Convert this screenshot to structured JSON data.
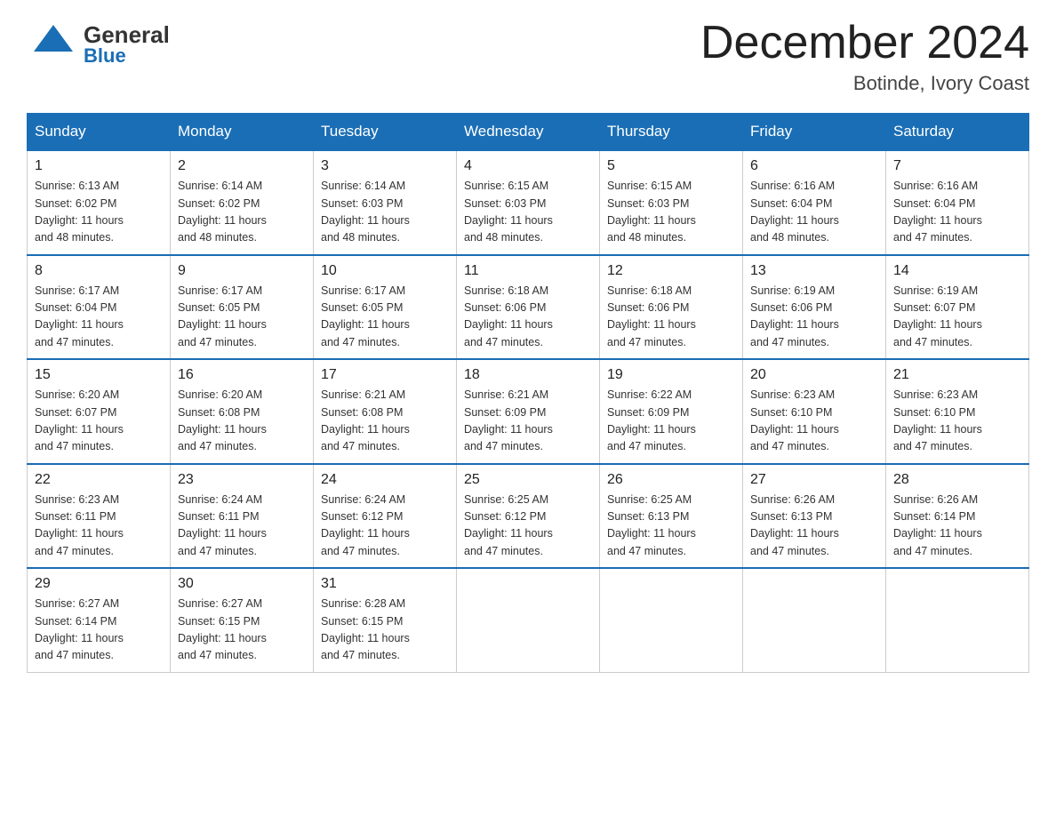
{
  "header": {
    "logo_general": "General",
    "logo_blue": "Blue",
    "month_title": "December 2024",
    "location": "Botinde, Ivory Coast"
  },
  "days_of_week": [
    "Sunday",
    "Monday",
    "Tuesday",
    "Wednesday",
    "Thursday",
    "Friday",
    "Saturday"
  ],
  "weeks": [
    [
      {
        "day": "1",
        "sunrise": "6:13 AM",
        "sunset": "6:02 PM",
        "daylight": "11 hours and 48 minutes."
      },
      {
        "day": "2",
        "sunrise": "6:14 AM",
        "sunset": "6:02 PM",
        "daylight": "11 hours and 48 minutes."
      },
      {
        "day": "3",
        "sunrise": "6:14 AM",
        "sunset": "6:03 PM",
        "daylight": "11 hours and 48 minutes."
      },
      {
        "day": "4",
        "sunrise": "6:15 AM",
        "sunset": "6:03 PM",
        "daylight": "11 hours and 48 minutes."
      },
      {
        "day": "5",
        "sunrise": "6:15 AM",
        "sunset": "6:03 PM",
        "daylight": "11 hours and 48 minutes."
      },
      {
        "day": "6",
        "sunrise": "6:16 AM",
        "sunset": "6:04 PM",
        "daylight": "11 hours and 48 minutes."
      },
      {
        "day": "7",
        "sunrise": "6:16 AM",
        "sunset": "6:04 PM",
        "daylight": "11 hours and 47 minutes."
      }
    ],
    [
      {
        "day": "8",
        "sunrise": "6:17 AM",
        "sunset": "6:04 PM",
        "daylight": "11 hours and 47 minutes."
      },
      {
        "day": "9",
        "sunrise": "6:17 AM",
        "sunset": "6:05 PM",
        "daylight": "11 hours and 47 minutes."
      },
      {
        "day": "10",
        "sunrise": "6:17 AM",
        "sunset": "6:05 PM",
        "daylight": "11 hours and 47 minutes."
      },
      {
        "day": "11",
        "sunrise": "6:18 AM",
        "sunset": "6:06 PM",
        "daylight": "11 hours and 47 minutes."
      },
      {
        "day": "12",
        "sunrise": "6:18 AM",
        "sunset": "6:06 PM",
        "daylight": "11 hours and 47 minutes."
      },
      {
        "day": "13",
        "sunrise": "6:19 AM",
        "sunset": "6:06 PM",
        "daylight": "11 hours and 47 minutes."
      },
      {
        "day": "14",
        "sunrise": "6:19 AM",
        "sunset": "6:07 PM",
        "daylight": "11 hours and 47 minutes."
      }
    ],
    [
      {
        "day": "15",
        "sunrise": "6:20 AM",
        "sunset": "6:07 PM",
        "daylight": "11 hours and 47 minutes."
      },
      {
        "day": "16",
        "sunrise": "6:20 AM",
        "sunset": "6:08 PM",
        "daylight": "11 hours and 47 minutes."
      },
      {
        "day": "17",
        "sunrise": "6:21 AM",
        "sunset": "6:08 PM",
        "daylight": "11 hours and 47 minutes."
      },
      {
        "day": "18",
        "sunrise": "6:21 AM",
        "sunset": "6:09 PM",
        "daylight": "11 hours and 47 minutes."
      },
      {
        "day": "19",
        "sunrise": "6:22 AM",
        "sunset": "6:09 PM",
        "daylight": "11 hours and 47 minutes."
      },
      {
        "day": "20",
        "sunrise": "6:23 AM",
        "sunset": "6:10 PM",
        "daylight": "11 hours and 47 minutes."
      },
      {
        "day": "21",
        "sunrise": "6:23 AM",
        "sunset": "6:10 PM",
        "daylight": "11 hours and 47 minutes."
      }
    ],
    [
      {
        "day": "22",
        "sunrise": "6:23 AM",
        "sunset": "6:11 PM",
        "daylight": "11 hours and 47 minutes."
      },
      {
        "day": "23",
        "sunrise": "6:24 AM",
        "sunset": "6:11 PM",
        "daylight": "11 hours and 47 minutes."
      },
      {
        "day": "24",
        "sunrise": "6:24 AM",
        "sunset": "6:12 PM",
        "daylight": "11 hours and 47 minutes."
      },
      {
        "day": "25",
        "sunrise": "6:25 AM",
        "sunset": "6:12 PM",
        "daylight": "11 hours and 47 minutes."
      },
      {
        "day": "26",
        "sunrise": "6:25 AM",
        "sunset": "6:13 PM",
        "daylight": "11 hours and 47 minutes."
      },
      {
        "day": "27",
        "sunrise": "6:26 AM",
        "sunset": "6:13 PM",
        "daylight": "11 hours and 47 minutes."
      },
      {
        "day": "28",
        "sunrise": "6:26 AM",
        "sunset": "6:14 PM",
        "daylight": "11 hours and 47 minutes."
      }
    ],
    [
      {
        "day": "29",
        "sunrise": "6:27 AM",
        "sunset": "6:14 PM",
        "daylight": "11 hours and 47 minutes."
      },
      {
        "day": "30",
        "sunrise": "6:27 AM",
        "sunset": "6:15 PM",
        "daylight": "11 hours and 47 minutes."
      },
      {
        "day": "31",
        "sunrise": "6:28 AM",
        "sunset": "6:15 PM",
        "daylight": "11 hours and 47 minutes."
      },
      null,
      null,
      null,
      null
    ]
  ],
  "labels": {
    "sunrise": "Sunrise:",
    "sunset": "Sunset:",
    "daylight": "Daylight:"
  }
}
